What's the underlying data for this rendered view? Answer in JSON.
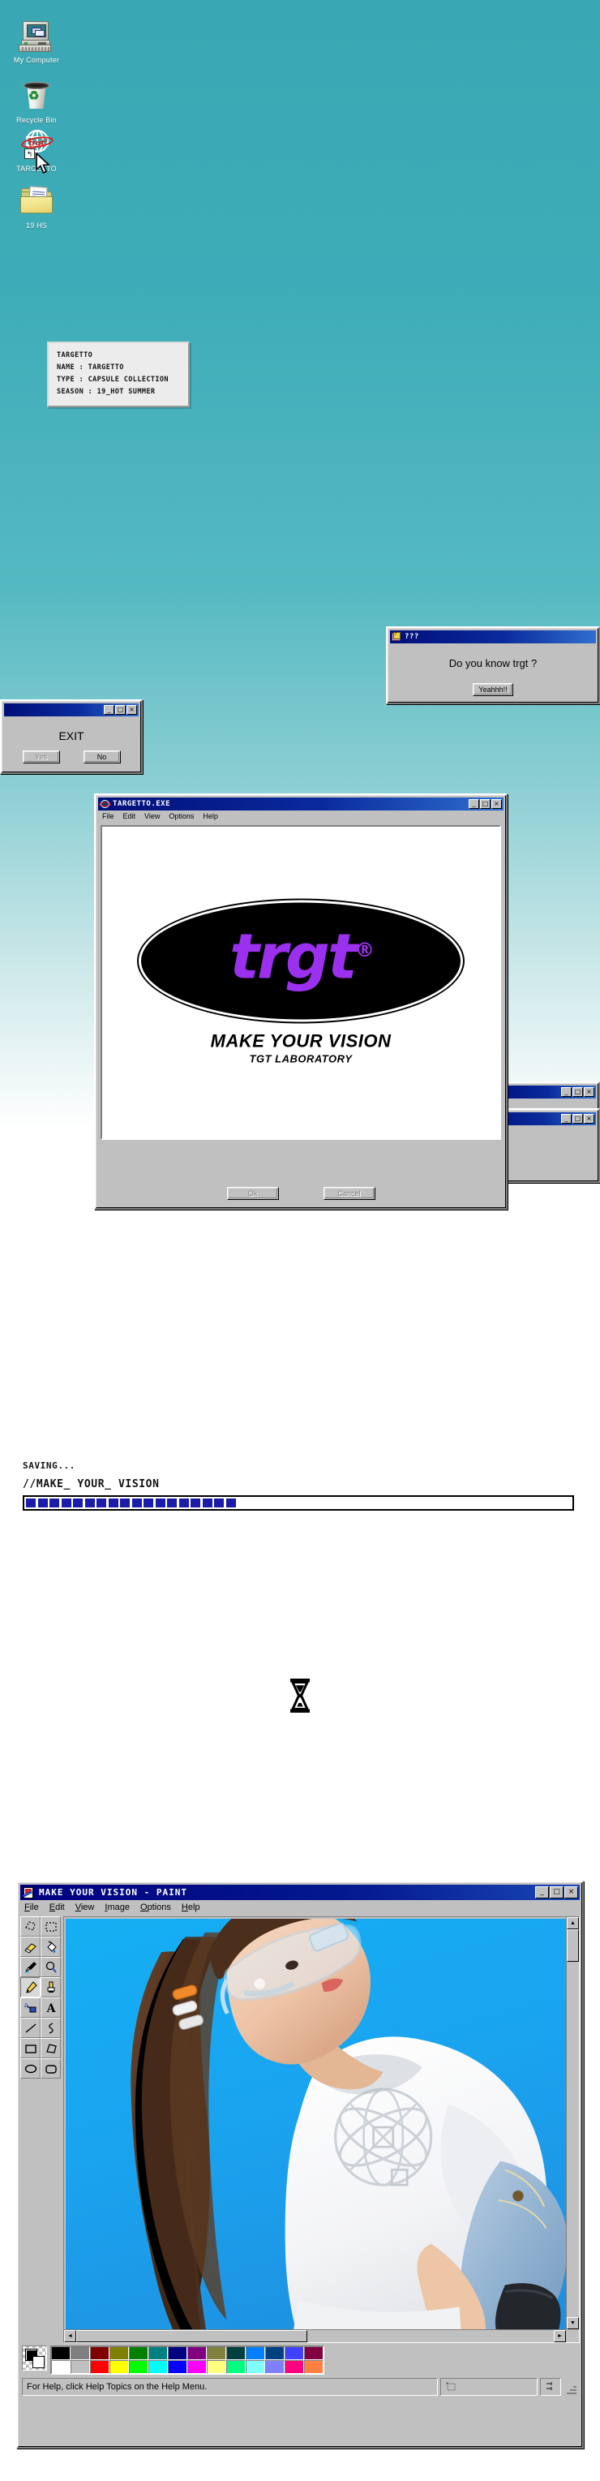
{
  "desktop": {
    "background_color": "#3aa8b4",
    "icons": [
      {
        "label": "My Computer",
        "icon": "computer-icon"
      },
      {
        "label": "Recycle Bin",
        "icon": "recycle-bin-icon"
      },
      {
        "label": "TARGETTO",
        "icon": "targetto-globe-icon",
        "logo_text": "trgt",
        "logo_reg": "®"
      },
      {
        "label": "19 HS",
        "icon": "folder-icon"
      }
    ]
  },
  "tooltip": {
    "title": "TARGETTO",
    "name_line": "NAME : TARGETTO",
    "type_line": "TYPE : CAPSULE COLLECTION",
    "season_line": "SEASON : 19_HOT SUMMER"
  },
  "dialog_question": {
    "title": "???",
    "message": "Do you know trgt ?",
    "button_label": "Yeahhh!!",
    "minimize": "_",
    "maximize": "□",
    "close": "×"
  },
  "dialog_exit": {
    "title": "",
    "message": "EXIT",
    "yes_label": "Yes",
    "no_label": "No",
    "minimize": "_",
    "maximize": "□",
    "close": "×"
  },
  "exe_window": {
    "title": "TARGETTO.EXE",
    "menu": [
      "File",
      "Edit",
      "View",
      "Options",
      "Help"
    ],
    "logo_text": "trgt",
    "logo_reg": "®",
    "tagline": "MAKE YOUR VISION",
    "sub_tagline": "TGT LABORATORY",
    "ok_label": "Ok",
    "cancel_label": "Cancel",
    "minimize": "_",
    "maximize": "□",
    "close": "×",
    "logo_color": "#9b30ef"
  },
  "saving": {
    "line1": "SAVING...",
    "line2": "//MAKE_ YOUR_ VISION",
    "progress_blocks_filled": 18,
    "progress_blocks_total": 42,
    "bar_color": "#1c1caa"
  },
  "hourglass": {
    "icon": "hourglass-icon"
  },
  "paint_window": {
    "title": "MAKE YOUR VISION - PAINT",
    "menu": [
      "File",
      "Edit",
      "View",
      "Image",
      "Options",
      "Help"
    ],
    "minimize": "_",
    "maximize": "□",
    "close": "×",
    "tools": [
      "free-form-select-tool",
      "rectangular-select-tool",
      "eraser-tool",
      "fill-tool",
      "color-picker-tool",
      "magnifier-tool",
      "pencil-tool",
      "brush-tool",
      "airbrush-tool",
      "text-tool",
      "line-tool",
      "curve-tool",
      "rectangle-tool",
      "polygon-tool",
      "ellipse-tool",
      "rounded-rectangle-tool"
    ],
    "selected_tool": "pencil-tool",
    "foreground_color": "#000000",
    "background_color": "#ffffff",
    "palette_row1": [
      "#000000",
      "#808080",
      "#800000",
      "#808000",
      "#008000",
      "#008080",
      "#000080",
      "#800080",
      "#808040",
      "#004040",
      "#0080ff",
      "#004080",
      "#4040ff",
      "#800040"
    ],
    "palette_row2": [
      "#ffffff",
      "#c0c0c0",
      "#ff0000",
      "#ffff00",
      "#00ff00",
      "#00ffff",
      "#0000ff",
      "#ff00ff",
      "#ffff80",
      "#00ff80",
      "#80ffff",
      "#8080ff",
      "#ff0080",
      "#ff8040"
    ],
    "status_text": "For Help, click Help Topics on the Help Menu.",
    "canvas_bg": "#1aa7f0",
    "scroll_left_arrow": "◄",
    "scroll_right_arrow": "►",
    "scroll_up_arrow": "▲",
    "scroll_down_arrow": "▼"
  }
}
